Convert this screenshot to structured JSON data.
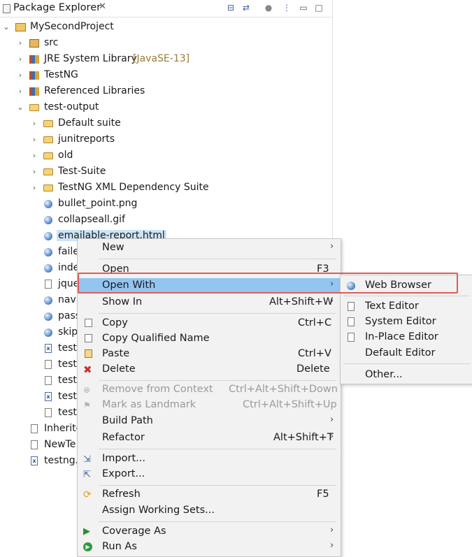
{
  "view": {
    "tab_title": "Package Explorer",
    "tab_close": "✕",
    "toolbar": [
      "collapse-all-icon",
      "link-with-editor-icon",
      "focus-icon",
      "view-menu-icon",
      "minimize-icon",
      "maximize-icon"
    ]
  },
  "tree": {
    "project": "MySecondProject",
    "src": "src",
    "jre": "JRE System Library",
    "jre_decoration": "[JavaSE-13]",
    "testng_lib": "TestNG",
    "ref_libs": "Referenced Libraries",
    "test_output": "test-output",
    "folders": [
      "Default suite",
      "junitreports",
      "old",
      "Test-Suite",
      "TestNG XML Dependency Suite"
    ],
    "files": [
      "bullet_point.png",
      "collapseall.gif",
      "emailable-report.html",
      "faile",
      "inde",
      "jque",
      "navi",
      "pass",
      "skip",
      "testr",
      "testr",
      "testr",
      "testr",
      "testr"
    ],
    "bottom": [
      "Inherite",
      "NewTe",
      "testng.x"
    ]
  },
  "context_menu": {
    "items": [
      {
        "label": "New",
        "shortcut": ""
      },
      {
        "label": "Open",
        "shortcut": "F3"
      },
      {
        "label": "Open With",
        "shortcut": ""
      },
      {
        "label": "Show In",
        "shortcut": "Alt+Shift+W"
      },
      {
        "label": "Copy",
        "shortcut": "Ctrl+C"
      },
      {
        "label": "Copy Qualified Name",
        "shortcut": ""
      },
      {
        "label": "Paste",
        "shortcut": "Ctrl+V"
      },
      {
        "label": "Delete",
        "shortcut": "Delete"
      },
      {
        "label": "Remove from Context",
        "shortcut": "Ctrl+Alt+Shift+Down"
      },
      {
        "label": "Mark as Landmark",
        "shortcut": "Ctrl+Alt+Shift+Up"
      },
      {
        "label": "Build Path",
        "shortcut": ""
      },
      {
        "label": "Refactor",
        "shortcut": "Alt+Shift+T"
      },
      {
        "label": "Import...",
        "shortcut": ""
      },
      {
        "label": "Export...",
        "shortcut": ""
      },
      {
        "label": "Refresh",
        "shortcut": "F5"
      },
      {
        "label": "Assign Working Sets...",
        "shortcut": ""
      },
      {
        "label": "Coverage As",
        "shortcut": ""
      },
      {
        "label": "Run As",
        "shortcut": ""
      }
    ],
    "submenu_arrow": "›"
  },
  "submenu": {
    "items": [
      "Web Browser",
      "Text Editor",
      "System Editor",
      "In-Place Editor",
      "Default Editor",
      "Other..."
    ]
  },
  "colors": {
    "highlight": "#92c5f0",
    "selection": "#cce4f7",
    "annotation_box": "#e05a5a"
  }
}
